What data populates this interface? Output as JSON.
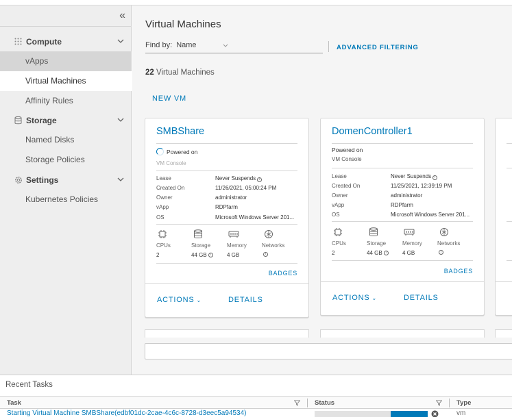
{
  "sidebar": {
    "collapse_glyph": "«",
    "groups": [
      {
        "label": "Compute",
        "icon": "compute-icon"
      },
      {
        "label": "Storage",
        "icon": "storage-icon"
      },
      {
        "label": "Settings",
        "icon": "gear-icon"
      }
    ],
    "items": [
      {
        "label": "vApps"
      },
      {
        "label": "Virtual Machines"
      },
      {
        "label": "Affinity Rules"
      },
      {
        "label": "Named Disks"
      },
      {
        "label": "Storage Policies"
      },
      {
        "label": "Kubernetes Policies"
      }
    ],
    "active_item": "Virtual Machines"
  },
  "main": {
    "title": "Virtual Machines",
    "find_by_label": "Find by:",
    "find_by_value": "Name",
    "advanced_filtering": "ADVANCED FILTERING",
    "count_number": "22",
    "count_label": "Virtual Machines",
    "new_vm": "NEW VM"
  },
  "card_labels": {
    "lease": "Lease",
    "created_on": "Created On",
    "owner": "Owner",
    "vapp": "vApp",
    "os": "OS",
    "cpus": "CPUs",
    "storage": "Storage",
    "memory": "Memory",
    "networks": "Networks",
    "badges": "BADGES",
    "actions": "ACTIONS",
    "details": "DETAILS",
    "vm_console": "VM Console"
  },
  "vms": [
    {
      "name": "SMBShare",
      "status": "Powered on",
      "lease": "Never Suspends",
      "created_on": "11/26/2021, 05:00:24 PM",
      "owner": "administrator",
      "vapp": "RDPfarm",
      "os": "Microsoft Windows Server 201...",
      "cpus": "2",
      "storage": "44 GB",
      "memory": "4 GB"
    },
    {
      "name": "DomenController1",
      "status": "Powered on",
      "lease": "Never Suspends",
      "created_on": "11/25/2021, 12:39:19 PM",
      "owner": "administrator",
      "vapp": "RDPfarm",
      "os": "Microsoft Windows Server 201...",
      "cpus": "2",
      "storage": "44 GB",
      "memory": "4 GB"
    }
  ],
  "recent_tasks": {
    "title": "Recent Tasks",
    "columns": [
      "Task",
      "Status",
      "Type"
    ],
    "rows": [
      {
        "task": "Starting Virtual Machine SMBShare(edbf01dc-2cae-4c6c-8728-d3eec5a94534)",
        "type": "vm",
        "progress": 0.33
      }
    ]
  },
  "colors": {
    "accent": "#0079b8",
    "sidebar_bg": "#eeeeee",
    "main_bg": "#f5f5f5"
  }
}
